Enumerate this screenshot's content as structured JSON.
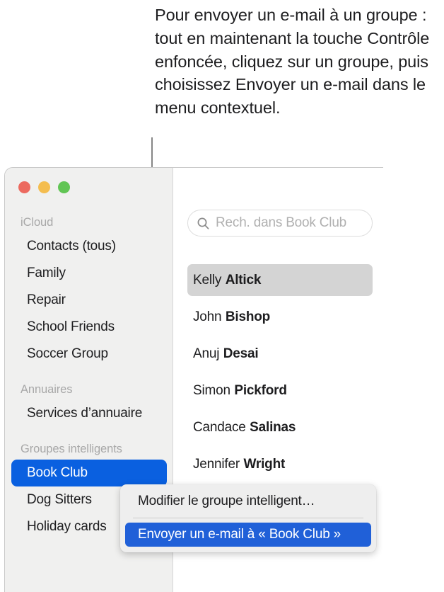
{
  "caption": {
    "text": "Pour envoyer un e-mail à un groupe : tout en maintenant la touche Contrôle enfoncée, cliquez sur un groupe, puis choisissez Envoyer un e-mail dans le menu contextuel."
  },
  "window": {
    "traffic_lights": [
      {
        "name": "close",
        "color": "#ec6a5f"
      },
      {
        "name": "minimize",
        "color": "#f4bd4f"
      },
      {
        "name": "zoom",
        "color": "#61c554"
      }
    ],
    "sidebar": {
      "sections": [
        {
          "header": "iCloud",
          "items": [
            {
              "label": "Contacts (tous)",
              "selected": false
            },
            {
              "label": "Family",
              "selected": false
            },
            {
              "label": "Repair",
              "selected": false
            },
            {
              "label": "School Friends",
              "selected": false
            },
            {
              "label": "Soccer Group",
              "selected": false
            }
          ]
        },
        {
          "header": "Annuaires",
          "items": [
            {
              "label": "Services d’annuaire",
              "selected": false
            }
          ]
        },
        {
          "header": "Groupes intelligents",
          "items": [
            {
              "label": "Book Club",
              "selected": true
            },
            {
              "label": "Dog Sitters",
              "selected": false
            },
            {
              "label": "Holiday cards",
              "selected": false
            }
          ]
        }
      ],
      "selected_color": "#0a60e0"
    },
    "content": {
      "search": {
        "icon": "search-icon",
        "value": "",
        "placeholder": "Rech. dans Book Club"
      },
      "contacts": [
        {
          "first": "Kelly",
          "last": "Altick",
          "selected": true
        },
        {
          "first": "John",
          "last": "Bishop",
          "selected": false
        },
        {
          "first": "Anuj",
          "last": "Desai",
          "selected": false
        },
        {
          "first": "Simon",
          "last": "Pickford",
          "selected": false
        },
        {
          "first": "Candace",
          "last": "Salinas",
          "selected": false
        },
        {
          "first": "Jennifer",
          "last": "Wright",
          "selected": false
        }
      ],
      "selected_row_color": "#d4d4d4"
    }
  },
  "context_menu": {
    "items": [
      {
        "label": "Modifier le groupe intelligent…",
        "highlighted": false
      },
      {
        "label": "Envoyer un e-mail à « Book Club »",
        "highlighted": true
      }
    ],
    "highlight_color": "#2060d8"
  }
}
